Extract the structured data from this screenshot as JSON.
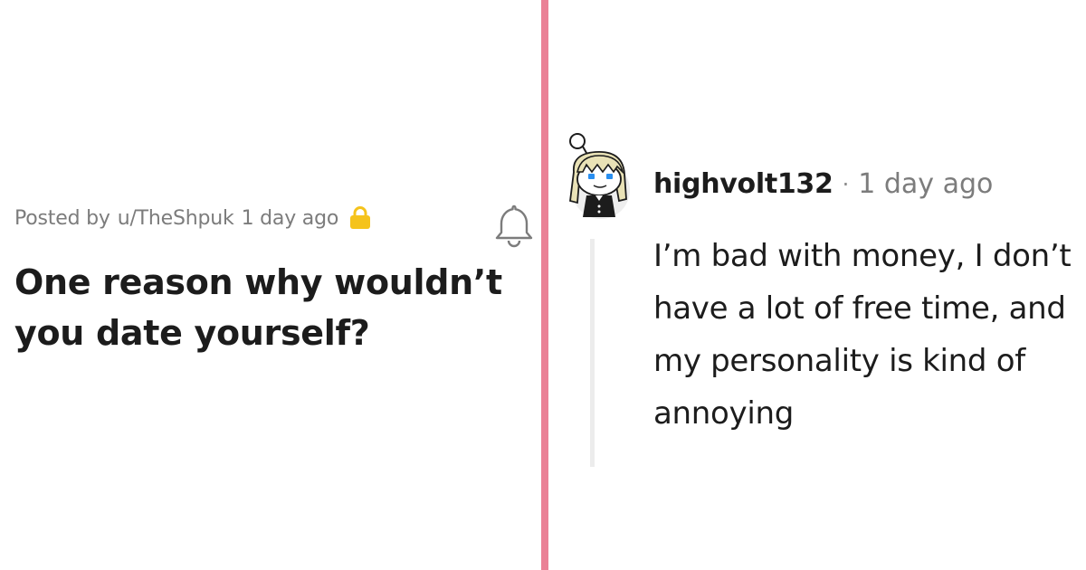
{
  "post": {
    "posted_by_prefix": "Posted by",
    "author": "u/TheShpuk",
    "age": "1 day ago",
    "title": "One reason why wouldn’t you date yourself?",
    "lock_color": "#f5c31c"
  },
  "comment": {
    "username": "highvolt132",
    "separator": "·",
    "age": "1 day ago",
    "body": "I’m bad with money, I don’t have a lot of free time, and my personality is kind of annoying"
  },
  "colors": {
    "divider": "#ea8196",
    "text_primary": "#1c1c1c",
    "text_secondary": "#7c7c7c",
    "thread_line": "#ececec"
  },
  "icons": {
    "lock": "lock-icon",
    "bell": "bell-icon",
    "avatar": "snoo-avatar"
  }
}
